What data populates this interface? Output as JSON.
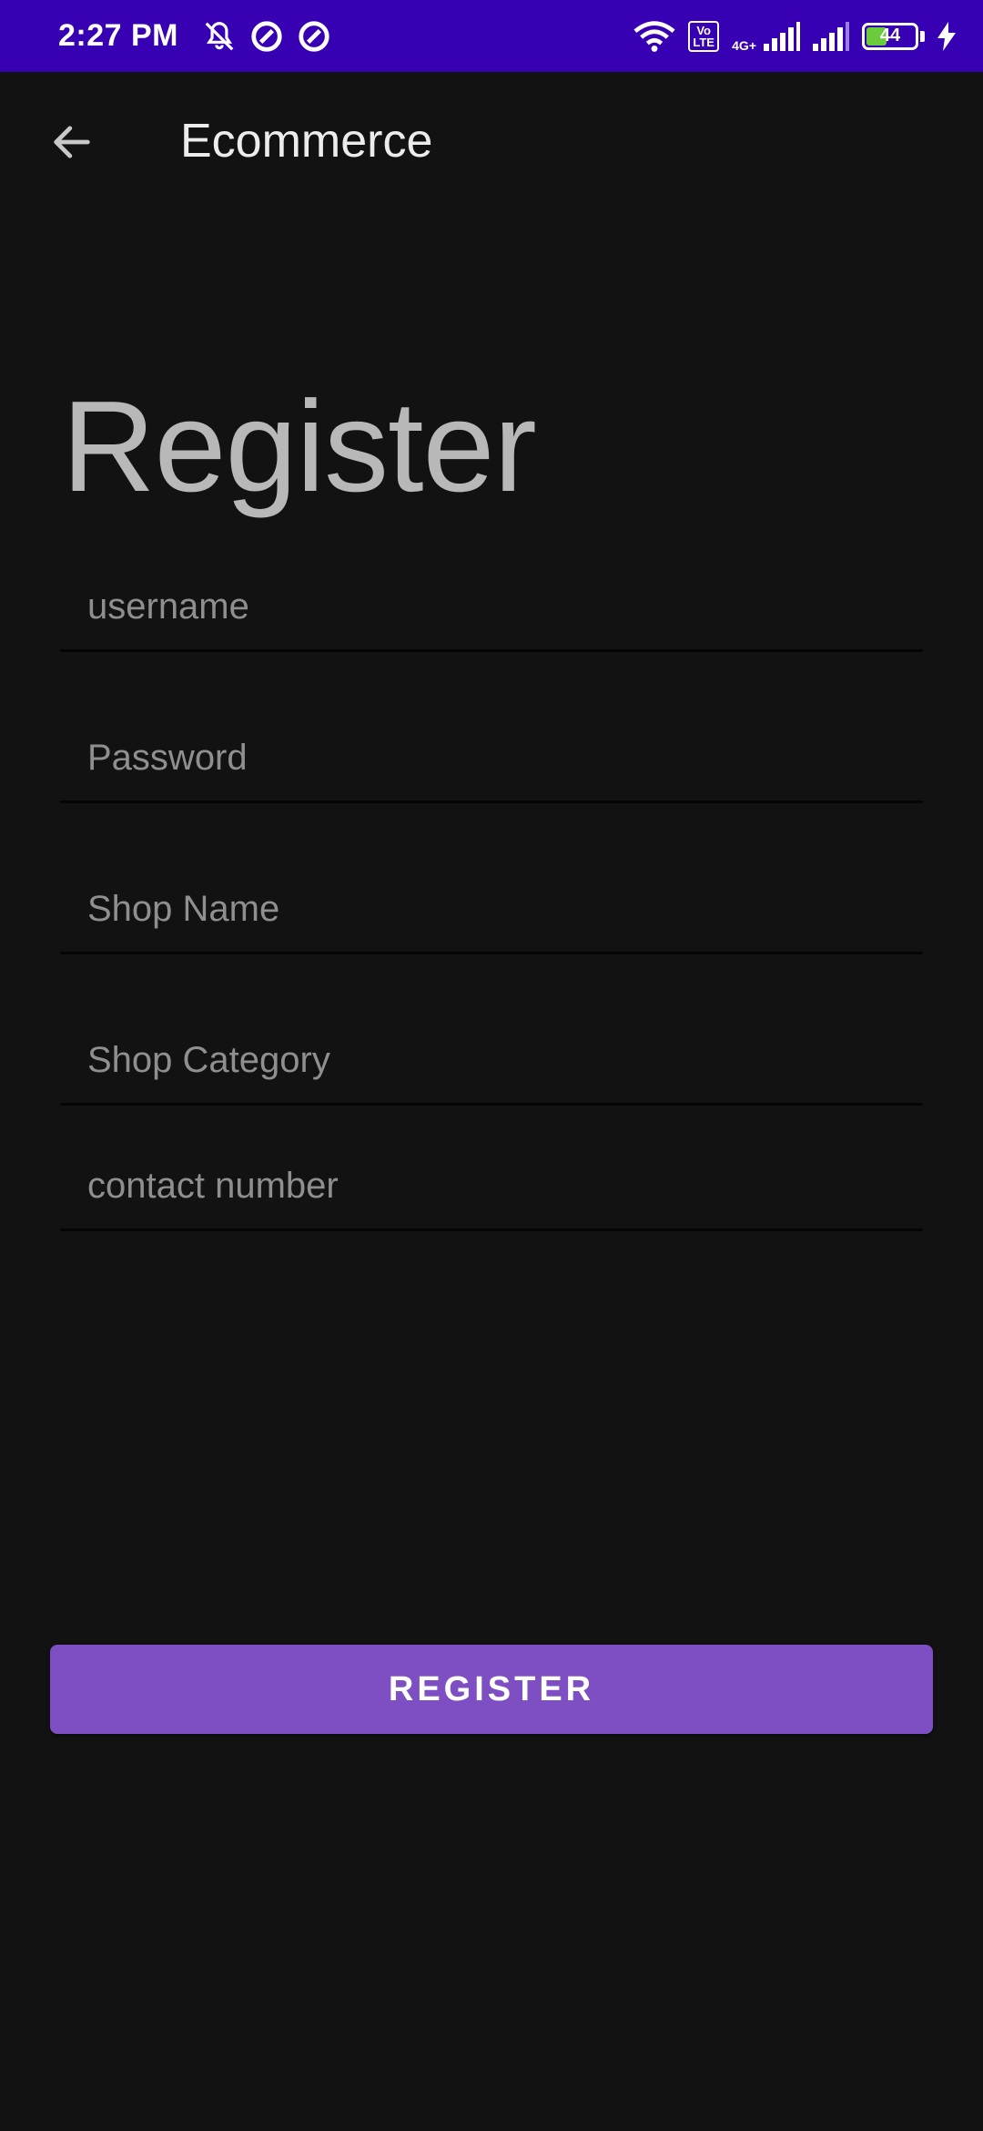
{
  "status_bar": {
    "time": "2:27 PM",
    "icons": [
      "mute-icon",
      "data-saver-icon",
      "data-saver-icon",
      "wifi-icon",
      "volte-icon",
      "signal-icon",
      "signal-icon",
      "battery-icon",
      "charging-icon"
    ],
    "volte_label": "Vo LTE",
    "network_label": "4G+",
    "battery_level": "44",
    "bg_color": "#3700B3"
  },
  "app_bar": {
    "title": "Ecommerce"
  },
  "form": {
    "heading": "Register",
    "fields": [
      {
        "placeholder": "username",
        "value": ""
      },
      {
        "placeholder": "Password",
        "value": ""
      },
      {
        "placeholder": "Shop Name",
        "value": ""
      },
      {
        "placeholder": "Shop Category",
        "value": ""
      },
      {
        "placeholder": "contact number",
        "value": ""
      }
    ],
    "submit_label": "REGISTER",
    "accent_color": "#7E4FC2"
  }
}
